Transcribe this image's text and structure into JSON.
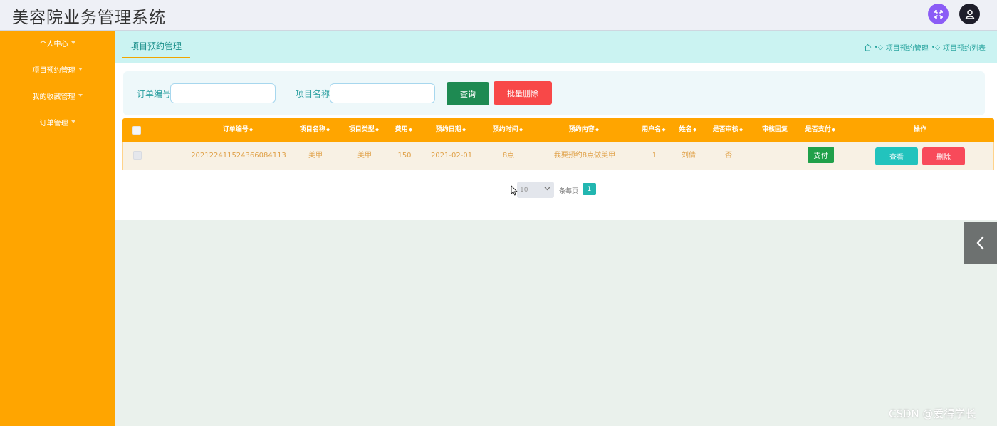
{
  "header": {
    "app_title": "美容院业务管理系统",
    "icons": [
      "expand-icon",
      "user-icon"
    ]
  },
  "sidebar": {
    "items": [
      {
        "label": "个人中心"
      },
      {
        "label": "项目预约管理"
      },
      {
        "label": "我的收藏管理"
      },
      {
        "label": "订单管理"
      }
    ]
  },
  "tabs": {
    "active": "项目预约管理"
  },
  "breadcrumb": {
    "home_icon": "home-icon",
    "items": [
      "项目预约管理",
      "项目预约列表"
    ]
  },
  "search": {
    "order_no_label": "订单编号",
    "order_no_value": "",
    "project_name_label": "项目名称",
    "project_name_value": "",
    "search_button": "查询",
    "batch_delete_button": "批量删除"
  },
  "table": {
    "columns": [
      "订单编号",
      "项目名称",
      "项目类型",
      "费用",
      "预约日期",
      "预约时间",
      "预约内容",
      "用户名",
      "姓名",
      "是否审核",
      "审核回复",
      "是否支付",
      "操作"
    ],
    "rows": [
      {
        "order_no": "20212241152436608411​3",
        "project_name": "美甲",
        "project_type": "美甲",
        "fee": "150",
        "date": "2021-02-01",
        "time": "8点",
        "content": "我要预约8点做美甲",
        "username": "1",
        "name": "刘倩",
        "audited": "否",
        "reply": "",
        "pay_button": "支付",
        "view_button": "查看",
        "delete_button": "删除"
      }
    ]
  },
  "pagination": {
    "page_size": "10",
    "per_page_label": "条每页",
    "current_page": "1"
  },
  "watermark": "CSDN @爱得学长",
  "colors": {
    "sidebar": "#ffa500",
    "table_header": "#ffa500",
    "tab_bar": "#cbf3f2",
    "accent_teal": "#22c3bd",
    "danger": "#f84848",
    "success": "#1e8a52"
  }
}
